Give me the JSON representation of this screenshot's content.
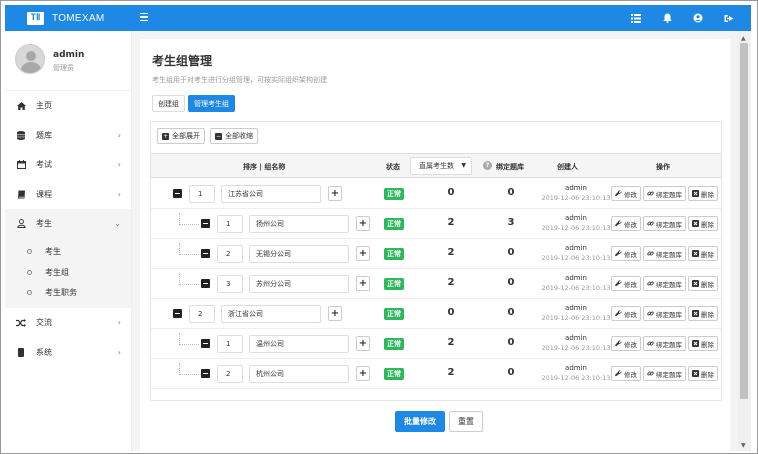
{
  "brand": {
    "logo_text": "TⅡ",
    "name": "TOMEXAM"
  },
  "user": {
    "name": "admin",
    "role": "管理员"
  },
  "sidebar": {
    "items": [
      {
        "label": "主页",
        "icon": "home-icon"
      },
      {
        "label": "题库",
        "icon": "database-icon"
      },
      {
        "label": "考试",
        "icon": "calendar-icon"
      },
      {
        "label": "课程",
        "icon": "book-icon"
      },
      {
        "label": "考生",
        "icon": "user-icon"
      },
      {
        "label": "交流",
        "icon": "shuffle-icon"
      },
      {
        "label": "系统",
        "icon": "mobile-icon"
      }
    ],
    "sub_items": [
      "考生",
      "考生组",
      "考生职务"
    ]
  },
  "page": {
    "title": "考生组管理",
    "desc": "考生组用于对考生进行分组管理，可按实际组织架构创建",
    "tabs": [
      "创建组",
      "管理考生组"
    ]
  },
  "toolbar": {
    "expand_all": "全部展开",
    "collapse_all": "全部收缩"
  },
  "table": {
    "headers": {
      "sort_name": "排序 | 组名称",
      "status": "状态",
      "count_select": "直属考生数",
      "bound_bank": "绑定题库",
      "creator": "创建人",
      "ops": "操作"
    },
    "op_labels": {
      "edit": "修改",
      "bind": "绑定题库",
      "delete": "删除"
    },
    "rows": [
      {
        "level": 0,
        "sort": "1",
        "name": "江苏省公司",
        "status": "正常",
        "count": "0",
        "bank": "0",
        "creator": "admin",
        "time": "2019-12-06 23:10:13"
      },
      {
        "level": 1,
        "sort": "1",
        "name": "扬州公司",
        "status": "正常",
        "count": "2",
        "bank": "3",
        "creator": "admin",
        "time": "2019-12-06 23:10:13"
      },
      {
        "level": 1,
        "sort": "2",
        "name": "无锡分公司",
        "status": "正常",
        "count": "2",
        "bank": "0",
        "creator": "admin",
        "time": "2019-12-06 23:10:13"
      },
      {
        "level": 1,
        "sort": "3",
        "name": "苏州分公司",
        "status": "正常",
        "count": "2",
        "bank": "0",
        "creator": "admin",
        "time": "2019-12-06 23:10:13"
      },
      {
        "level": 0,
        "sort": "2",
        "name": "浙江省公司",
        "status": "正常",
        "count": "0",
        "bank": "0",
        "creator": "admin",
        "time": "2019-12-06 23:10:13"
      },
      {
        "level": 1,
        "sort": "1",
        "name": "温州公司",
        "status": "正常",
        "count": "2",
        "bank": "0",
        "creator": "admin",
        "time": "2019-12-06 23:10:13"
      },
      {
        "level": 1,
        "sort": "2",
        "name": "杭州公司",
        "status": "正常",
        "count": "2",
        "bank": "0",
        "creator": "admin",
        "time": "2019-12-06 23:10:13"
      }
    ]
  },
  "actions": {
    "batch_edit": "批量修改",
    "reset": "重置"
  },
  "colors": {
    "primary": "#1e88e5",
    "success": "#2eb85c"
  }
}
